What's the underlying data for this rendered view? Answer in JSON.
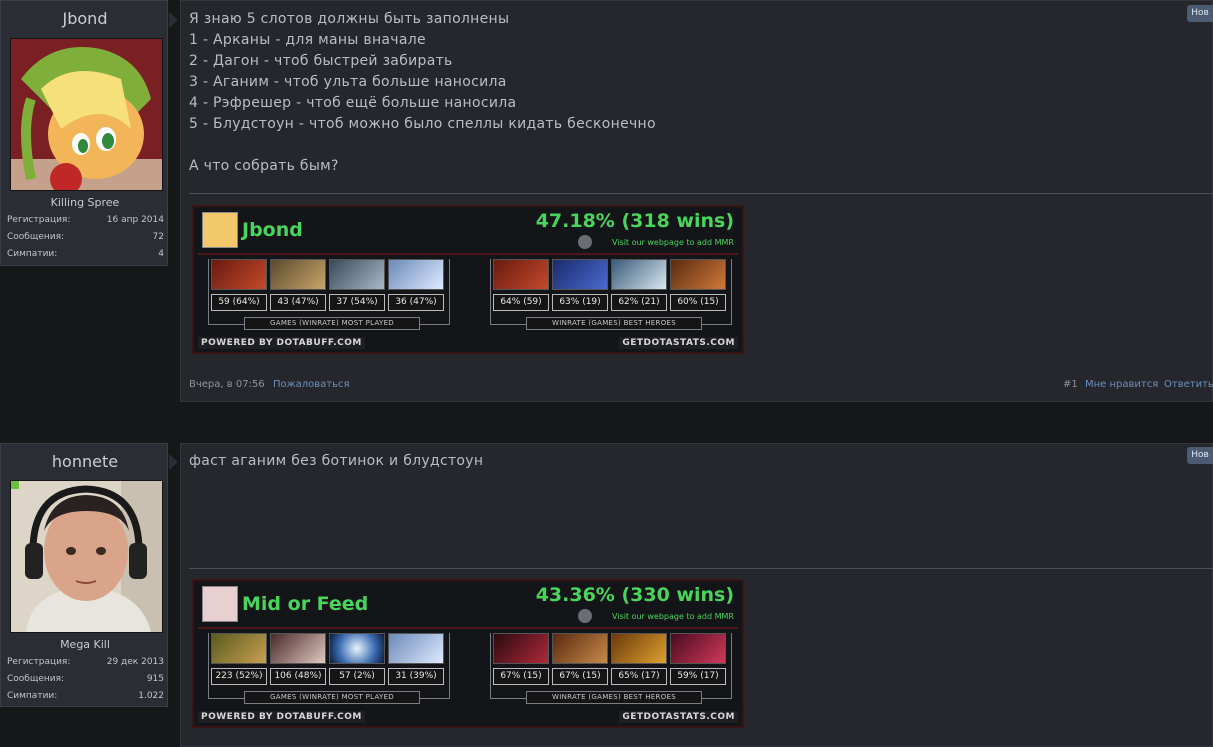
{
  "post1": {
    "username": "Jbond",
    "rank": "Killing Spree",
    "stats": [
      {
        "label": "Регистрация:",
        "value": "16 апр 2014"
      },
      {
        "label": "Сообщения:",
        "value": "72"
      },
      {
        "label": "Симпатии:",
        "value": "4"
      }
    ],
    "text": "Я знаю 5 слотов должны быть заполнены\n1 - Арканы - для маны вначале\n2 - Дагон - чтоб быстрей забирать\n3 - Аганим - чтоб ульта больше наносила\n4 - Рэфрешер - чтоб ещё больше наносила\n5 - Блудстоун - чтоб можно было спеллы кидать бесконечно\n\nА что собрать бым?",
    "new_badge": "Нов",
    "sig": {
      "name": "Jbond",
      "winrate": "47.18% (318 wins)",
      "visit": "Visit our webpage to add MMR",
      "most_played": [
        "59 (64%)",
        "43 (47%)",
        "37 (54%)",
        "36 (47%)"
      ],
      "best_heroes": [
        "64% (59)",
        "63% (19)",
        "62% (21)",
        "60% (15)"
      ],
      "most_played_label": "GAMES (WINRATE) MOST PLAYED",
      "best_heroes_label": "WINRATE (GAMES) BEST HEROES",
      "powered": "POWERED BY DOTABUFF.COM",
      "site": "GETDOTASTATS.COM"
    },
    "date": "Вчера, в 07:56",
    "report": "Пожаловаться",
    "number": "#1",
    "like": "Мне нравится",
    "reply": "Ответить"
  },
  "post2": {
    "username": "honnete",
    "rank": "Mega Kill",
    "stats": [
      {
        "label": "Регистрация:",
        "value": "29 дек 2013"
      },
      {
        "label": "Сообщения:",
        "value": "915"
      },
      {
        "label": "Симпатии:",
        "value": "1.022"
      }
    ],
    "text": "фаст аганим без ботинок и блудстоун",
    "new_badge": "Нов",
    "sig": {
      "name": "Mid or Feed",
      "winrate": "43.36% (330 wins)",
      "visit": "Visit our webpage to add MMR",
      "most_played": [
        "223 (52%)",
        "106 (48%)",
        "57 (2%)",
        "31 (39%)"
      ],
      "best_heroes": [
        "67% (15)",
        "67% (15)",
        "65% (17)",
        "59% (17)"
      ],
      "most_played_label": "GAMES (WINRATE) MOST PLAYED",
      "best_heroes_label": "WINRATE (GAMES) BEST HEROES",
      "powered": "POWERED BY DOTABUFF.COM",
      "site": "GETDOTASTATS.COM"
    }
  },
  "colors": {
    "accent_green": "#49d45b",
    "link_blue": "#6d8fbf",
    "badge": "#4c5b74"
  }
}
